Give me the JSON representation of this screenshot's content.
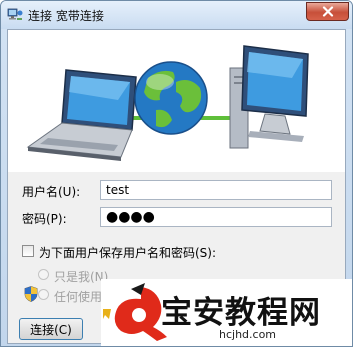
{
  "window": {
    "title": "连接 宽带连接",
    "app_icon": "network-connection-icon",
    "close_icon": "close-icon"
  },
  "banner": {
    "icons": [
      "laptop-icon",
      "globe-icon",
      "desktop-computer-icon"
    ]
  },
  "form": {
    "username_label": "用户名(U):",
    "username_value": "test",
    "password_label": "密码(P):",
    "password_value": "●●●●"
  },
  "save_option": {
    "checkbox_label": "为下面用户保存用户名和密码(S):",
    "checked": false,
    "radio_me": "只是我(N)",
    "radio_anyone": "任何使用"
  },
  "buttons": {
    "connect_label": "连接(C)"
  },
  "watermark": {
    "brand": "宝安教程网",
    "domain": "hcjhd.com",
    "colors": {
      "logo_red": "#e02a1a",
      "logo_black": "#1a1a1a"
    }
  },
  "colors": {
    "accent": "#3c7fb1",
    "titlebar": "#c9dcf1",
    "close_button": "#c7503a",
    "cable_green": "#5fbf3a"
  }
}
